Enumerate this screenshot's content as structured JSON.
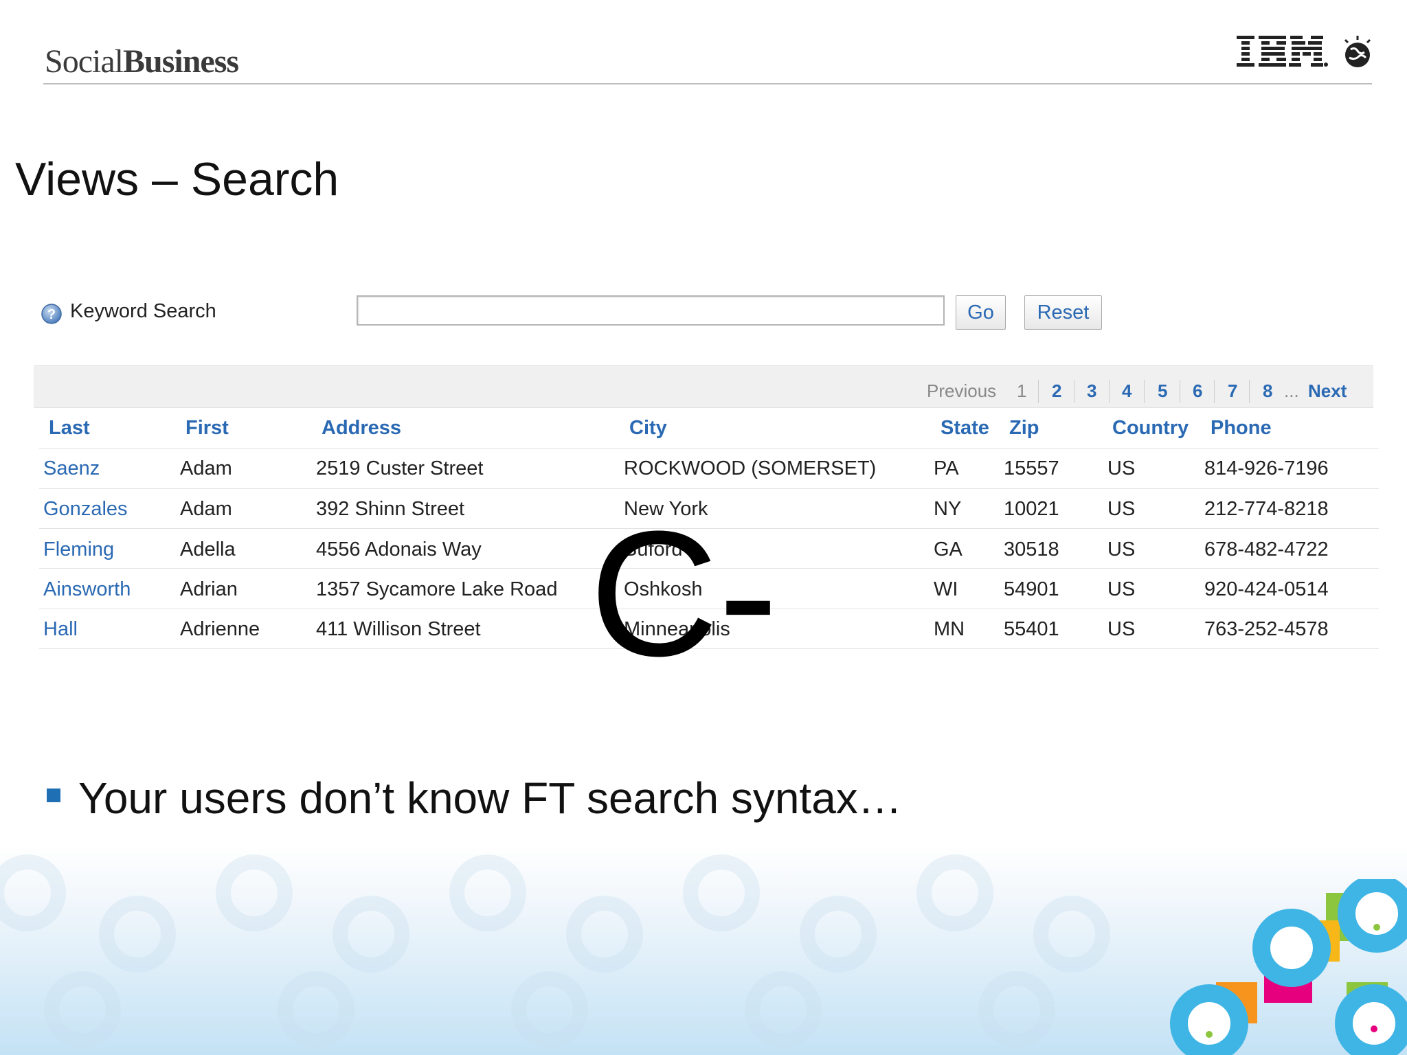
{
  "header": {
    "brand_light": "Social",
    "brand_bold": "Business",
    "logo_text": "IBM"
  },
  "slide_title": "Views – Search",
  "search": {
    "label": "Keyword Search",
    "value": "",
    "go_label": "Go",
    "reset_label": "Reset"
  },
  "pager": {
    "previous": "Previous",
    "current": "1",
    "pages": [
      "2",
      "3",
      "4",
      "5",
      "6",
      "7",
      "8"
    ],
    "ellipsis": "...",
    "next": "Next"
  },
  "table": {
    "columns": [
      "Last",
      "First",
      "Address",
      "City",
      "State",
      "Zip",
      "Country",
      "Phone"
    ],
    "rows": [
      [
        "Saenz",
        "Adam",
        "2519 Custer Street",
        "ROCKWOOD (SOMERSET)",
        "PA",
        "15557",
        "US",
        "814-926-7196"
      ],
      [
        "Gonzales",
        "Adam",
        "392 Shinn Street",
        "New York",
        "NY",
        "10021",
        "US",
        "212-774-8218"
      ],
      [
        "Fleming",
        "Adella",
        "4556 Adonais Way",
        "Buford",
        "GA",
        "30518",
        "US",
        "678-482-4722"
      ],
      [
        "Ainsworth",
        "Adrian",
        "1357 Sycamore Lake Road",
        "Oshkosh",
        "WI",
        "54901",
        "US",
        "920-424-0514"
      ],
      [
        "Hall",
        "Adrienne",
        "411 Willison Street",
        "Minneapolis",
        "MN",
        "55401",
        "US",
        "763-252-4578"
      ]
    ]
  },
  "overlay_mark": "C-",
  "bullet": "Your users don’t know FT search syntax…",
  "colors": {
    "link": "#2a69b3",
    "bullet": "#1f6fb5",
    "pager_bg": "#f0f0f0"
  }
}
